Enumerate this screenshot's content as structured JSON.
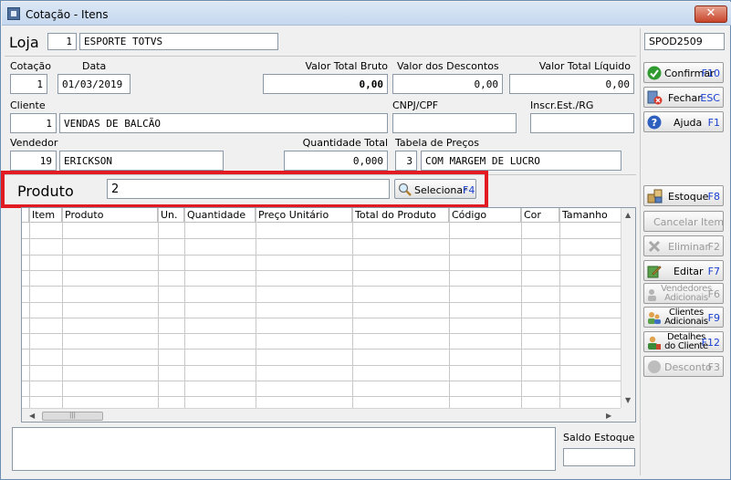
{
  "window": {
    "title": "Cotação - Itens",
    "close_label": "✕"
  },
  "loja": {
    "label": "Loja",
    "code": "1",
    "name": "ESPORTE TOTVS"
  },
  "station_id": "SPOD2509",
  "header": {
    "cotacao_label": "Cotação",
    "cotacao": "1",
    "data_label": "Data",
    "data": "01/03/2019",
    "valor_bruto_label": "Valor Total Bruto",
    "valor_bruto": "0,00",
    "descontos_label": "Valor dos Descontos",
    "descontos": "0,00",
    "valor_liquido_label": "Valor Total Líquido",
    "valor_liquido": "0,00",
    "cliente_label": "Cliente",
    "cliente_code": "1",
    "cliente_name": "VENDAS DE BALCÃO",
    "cnpj_label": "CNPJ/CPF",
    "cnpj": "",
    "inscr_label": "Inscr.Est./RG",
    "inscr": "",
    "vendedor_label": "Vendedor",
    "vendedor_code": "19",
    "vendedor_name": "ERICKSON",
    "qtd_total_label": "Quantidade Total",
    "qtd_total": "0,000",
    "tabela_label": "Tabela de Preços",
    "tabela_code": "3",
    "tabela_name": "COM MARGEM DE LUCRO"
  },
  "produto": {
    "label": "Produto",
    "value": "2",
    "select_label": "Selecionar",
    "select_key": "F4"
  },
  "grid": {
    "columns": [
      "Item",
      "Produto",
      "Un.",
      "Quantidade",
      "Preço Unitário",
      "Total do Produto",
      "Código",
      "Cor",
      "Tamanho"
    ],
    "rows": []
  },
  "side_buttons": {
    "confirmar": {
      "label": "Confirmar",
      "key": "F10"
    },
    "fechar": {
      "label": "Fechar",
      "key": "ESC"
    },
    "ajuda": {
      "label": "Ajuda",
      "key": "F1"
    },
    "estoque": {
      "label": "Estoque",
      "key": "F8"
    },
    "cancelar_item": {
      "label": "Cancelar Item"
    },
    "eliminar": {
      "label": "Eliminar",
      "key": "F2"
    },
    "editar": {
      "label": "Editar",
      "key": "F7"
    },
    "vendedores": {
      "label_1": "Vendedores",
      "label_2": "Adicionais",
      "key": "F6"
    },
    "clientes": {
      "label_1": "Clientes",
      "label_2": "Adicionais",
      "key": "F9"
    },
    "detalhes": {
      "label_1": "Detalhes",
      "label_2": "do Cliente",
      "key": "F12"
    },
    "desconto": {
      "label": "Desconto",
      "key": "F3"
    }
  },
  "footer": {
    "observacao": "",
    "saldo_label": "Saldo Estoque",
    "saldo": ""
  },
  "colors": {
    "accent_key": "#1a3fd0",
    "highlight": "#e21b23"
  }
}
